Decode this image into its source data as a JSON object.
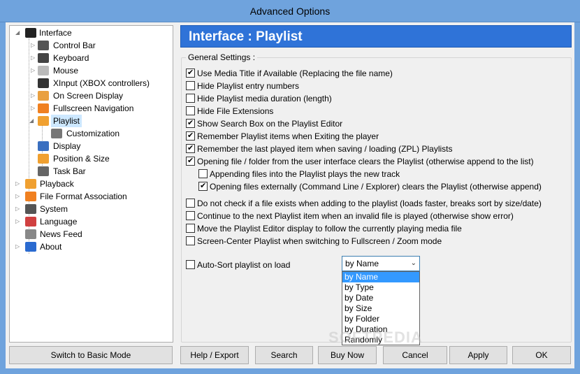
{
  "window": {
    "title": "Advanced Options"
  },
  "tree": {
    "items": [
      {
        "label": "Interface",
        "icon": "interface-icon",
        "expander": "◢",
        "color": "#222"
      },
      {
        "label": "Control Bar",
        "icon": "control-bar-icon",
        "expander": "▷",
        "color": "#555"
      },
      {
        "label": "Keyboard",
        "icon": "keyboard-icon",
        "expander": "▷",
        "color": "#444"
      },
      {
        "label": "Mouse",
        "icon": "mouse-icon",
        "expander": "▷",
        "color": "#bbb"
      },
      {
        "label": "XInput (XBOX controllers)",
        "icon": "gamepad-icon",
        "expander": "",
        "color": "#333"
      },
      {
        "label": "On Screen Display",
        "icon": "osd-icon",
        "expander": "▷",
        "color": "#e9a040"
      },
      {
        "label": "Fullscreen Navigation",
        "icon": "fullscreen-icon",
        "expander": "▷",
        "color": "#f08020"
      },
      {
        "label": "Playlist",
        "icon": "playlist-icon",
        "expander": "◢",
        "color": "#f0a030"
      },
      {
        "label": "Customization",
        "icon": "gears-icon",
        "expander": "",
        "color": "#777"
      },
      {
        "label": "Display",
        "icon": "display-icon",
        "expander": "",
        "color": "#3a6fc0"
      },
      {
        "label": "Position & Size",
        "icon": "position-icon",
        "expander": "",
        "color": "#f0a030"
      },
      {
        "label": "Task Bar",
        "icon": "taskbar-icon",
        "expander": "",
        "color": "#666"
      },
      {
        "label": "Playback",
        "icon": "playback-icon",
        "expander": "▷",
        "color": "#f0a030"
      },
      {
        "label": "File Format Association",
        "icon": "file-assoc-icon",
        "expander": "▷",
        "color": "#f08020"
      },
      {
        "label": "System",
        "icon": "system-gear-icon",
        "expander": "▷",
        "color": "#555"
      },
      {
        "label": "Language",
        "icon": "language-globe-icon",
        "expander": "▷",
        "color": "#d04040"
      },
      {
        "label": "News Feed",
        "icon": "news-icon",
        "expander": "",
        "color": "#888"
      },
      {
        "label": "About",
        "icon": "about-info-icon",
        "expander": "▷",
        "color": "#2a6ad0"
      }
    ]
  },
  "header": {
    "title": "Interface : Playlist"
  },
  "group": {
    "label": "General Settings :"
  },
  "options": [
    {
      "label": "Use Media Title if Available (Replacing the file name)",
      "checked": true
    },
    {
      "label": "Hide Playlist entry numbers",
      "checked": false
    },
    {
      "label": "Hide Playlist media duration (length)",
      "checked": false
    },
    {
      "label": "Hide File Extensions",
      "checked": false
    },
    {
      "label": "Show Search Box on the Playlist Editor",
      "checked": true
    },
    {
      "label": "Remember Playlist items when Exiting the player",
      "checked": true
    },
    {
      "label": "Remember the last played item when saving / loading (ZPL) Playlists",
      "checked": true
    },
    {
      "label": "Opening file / folder from the user interface clears the Playlist (otherwise append to the list)",
      "checked": true
    },
    {
      "label": "Appending files into the Playlist plays the new track",
      "checked": false
    },
    {
      "label": "Opening files externally (Command Line / Explorer) clears the Playlist (otherwise append)",
      "checked": true
    },
    {
      "label": "Do not check if a file exists when adding to the playlist (loads faster, breaks sort by size/date)",
      "checked": false
    },
    {
      "label": "Continue to the next Playlist item when an invalid file is played (otherwise show error)",
      "checked": false
    },
    {
      "label": "Move the Playlist Editor display to follow the currently playing media file",
      "checked": false
    },
    {
      "label": "Screen-Center Playlist when switching to Fullscreen / Zoom mode",
      "checked": false
    },
    {
      "label": "Auto-Sort playlist on load",
      "checked": false
    }
  ],
  "sort": {
    "selected": "by Name",
    "options": [
      "by Name",
      "by Type",
      "by Date",
      "by Size",
      "by Folder",
      "by Duration",
      "Randomly"
    ]
  },
  "buttons": {
    "basic_mode": "Switch to Basic Mode",
    "help": "Help / Export",
    "search": "Search",
    "buy": "Buy Now",
    "cancel": "Cancel",
    "apply": "Apply",
    "ok": "OK"
  },
  "watermark": "SOFTPEDIA"
}
